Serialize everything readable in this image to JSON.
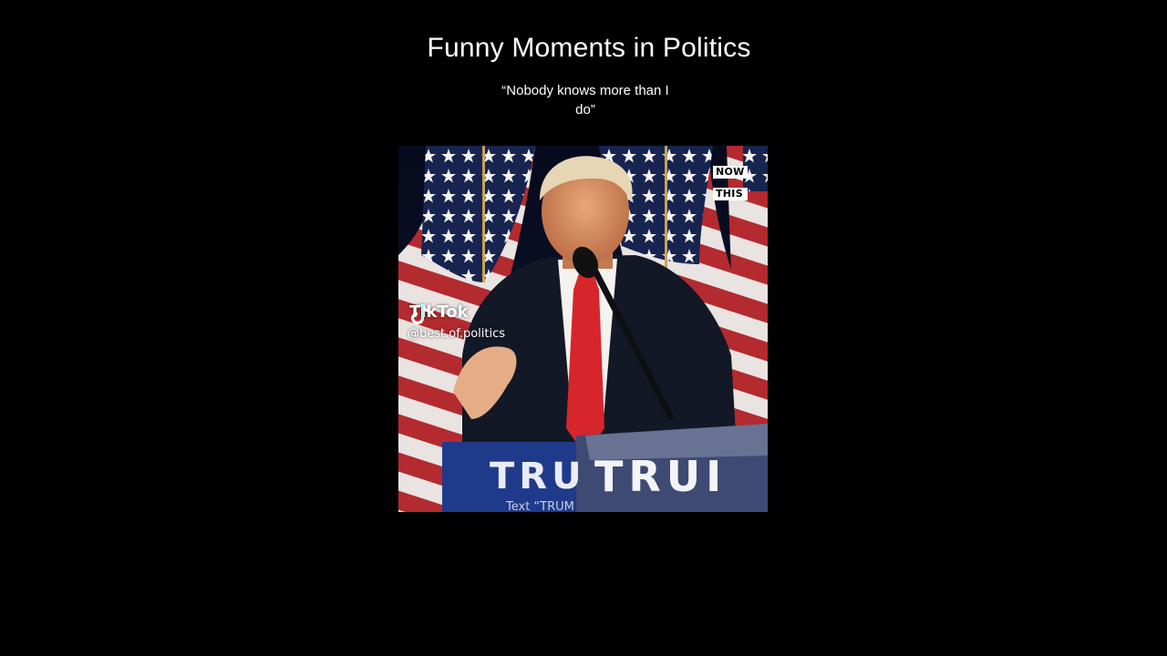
{
  "post": {
    "title": "Funny Moments in Politics",
    "caption_line1": "“Nobody knows more than I",
    "caption_line2": "do”"
  },
  "video": {
    "watermark_top": "NOW",
    "watermark_bottom": "THIS",
    "platform_name": "TikTok",
    "platform_icon": "tiktok-note-icon",
    "handle": "@best.of.politics",
    "podium_text_left": "TRU",
    "podium_text_right": "TRUI",
    "podium_subtext": "Text “TRUM"
  },
  "colors": {
    "background": "#000000",
    "flag_red": "#b1262c",
    "flag_blue": "#1c2a58",
    "tie_red": "#d6262b",
    "podium_blue": "#1f3a8a"
  }
}
